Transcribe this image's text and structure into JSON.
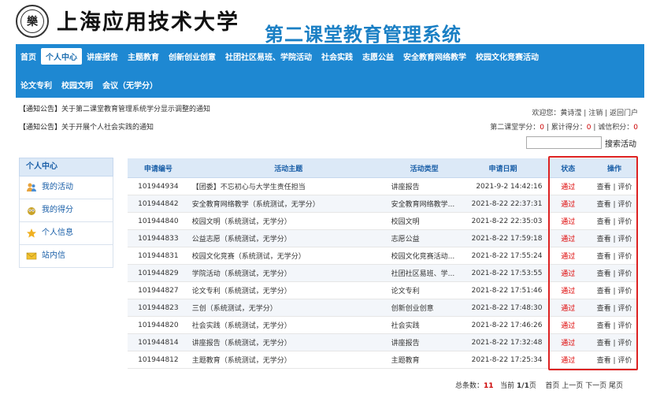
{
  "header": {
    "logo_char": "樂",
    "university": "上海应用技术大学",
    "system_name": "第二课堂教育管理系统"
  },
  "nav": {
    "row1": [
      "首页",
      "个人中心",
      "讲座报告",
      "主题教育",
      "创新创业创意",
      "社团社区易班、学院活动",
      "社会实践",
      "志愿公益",
      "安全教育网络教学",
      "校园文化竞赛活动"
    ],
    "row2": [
      "论文专利",
      "校园文明",
      "会议（无学分）"
    ]
  },
  "notices": [
    {
      "tag": "【通知公告】",
      "text": "关于第二课堂教育管理系统学分显示调整的通知"
    },
    {
      "tag": "【通知公告】",
      "text": "关于开展个人社会实践的通知"
    }
  ],
  "user": {
    "welcome": "欢迎您：黄诗滢",
    "logout": "注销",
    "portal": "返回门户",
    "credit_label": "第二课堂学分：",
    "credit_value": "0",
    "total_label": "累计得分：",
    "total_value": "0",
    "integrity_label": "诚信积分：",
    "integrity_value": "0"
  },
  "search": {
    "button": "搜索活动"
  },
  "sidebar": {
    "title": "个人中心",
    "items": [
      {
        "label": "我的活动",
        "icon": "people-icon"
      },
      {
        "label": "我的得分",
        "icon": "owl-icon"
      },
      {
        "label": "个人信息",
        "icon": "star-icon"
      },
      {
        "label": "站内信",
        "icon": "mail-icon"
      }
    ]
  },
  "table": {
    "headers": [
      "申请编号",
      "活动主题",
      "活动类型",
      "申请日期",
      "状态",
      "操作"
    ],
    "rows": [
      {
        "id": "101944934",
        "topic": "【团委】不忘初心与大学生责任担当",
        "type": "讲座报告",
        "date": "2021-9-2 14:42:16",
        "status": "通过"
      },
      {
        "id": "101944842",
        "topic": "安全教育网络教学（系统测试，无学分）",
        "type": "安全教育网络教学...",
        "date": "2021-8-22 22:37:31",
        "status": "通过"
      },
      {
        "id": "101944840",
        "topic": "校园文明（系统测试，无学分）",
        "type": "校园文明",
        "date": "2021-8-22 22:35:03",
        "status": "通过"
      },
      {
        "id": "101944833",
        "topic": "公益志愿（系统测试，无学分）",
        "type": "志愿公益",
        "date": "2021-8-22 17:59:18",
        "status": "通过"
      },
      {
        "id": "101944831",
        "topic": "校园文化竞赛（系统测试，无学分）",
        "type": "校园文化竞赛活动...",
        "date": "2021-8-22 17:55:24",
        "status": "通过"
      },
      {
        "id": "101944829",
        "topic": "学院活动（系统测试，无学分）",
        "type": "社团社区易班、学...",
        "date": "2021-8-22 17:53:55",
        "status": "通过"
      },
      {
        "id": "101944827",
        "topic": "论文专利（系统测试，无学分）",
        "type": "论文专利",
        "date": "2021-8-22 17:51:46",
        "status": "通过"
      },
      {
        "id": "101944823",
        "topic": "三创（系统测试，无学分）",
        "type": "创新创业创意",
        "date": "2021-8-22 17:48:30",
        "status": "通过"
      },
      {
        "id": "101944820",
        "topic": "社会实践（系统测试，无学分）",
        "type": "社会实践",
        "date": "2021-8-22 17:46:26",
        "status": "通过"
      },
      {
        "id": "101944814",
        "topic": "讲座报告（系统测试，无学分）",
        "type": "讲座报告",
        "date": "2021-8-22 17:32:48",
        "status": "通过"
      },
      {
        "id": "101944812",
        "topic": "主题教育（系统测试，无学分）",
        "type": "主题教育",
        "date": "2021-8-22 17:25:34",
        "status": "通过"
      }
    ],
    "view_label": "查看",
    "rate_label": "评价"
  },
  "footer": {
    "total_label": "总条数：",
    "total_value": "11",
    "page_label": "当前",
    "page_value": "1/1",
    "page_suffix": "页",
    "first": "首页",
    "prev": "上一页",
    "next": "下一页",
    "last": "尾页"
  }
}
